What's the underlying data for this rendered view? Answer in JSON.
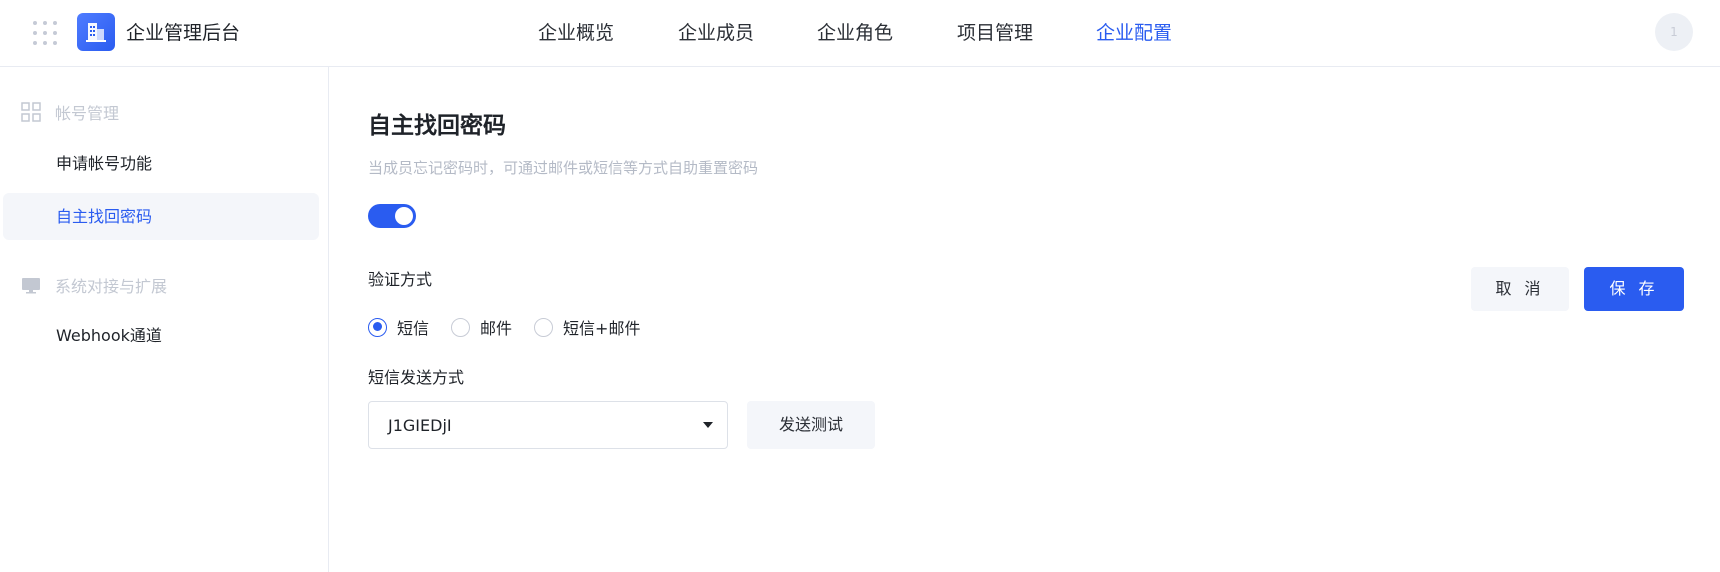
{
  "header": {
    "app_title": "企业管理后台",
    "nav": [
      {
        "label": "企业概览",
        "active": false
      },
      {
        "label": "企业成员",
        "active": false
      },
      {
        "label": "企业角色",
        "active": false
      },
      {
        "label": "项目管理",
        "active": false
      },
      {
        "label": "企业配置",
        "active": true
      }
    ],
    "avatar_text": "1"
  },
  "sidebar": {
    "groups": [
      {
        "label": "帐号管理",
        "icon": "grid-icon",
        "items": [
          {
            "label": "申请帐号功能",
            "active": false
          },
          {
            "label": "自主找回密码",
            "active": true
          }
        ]
      },
      {
        "label": "系统对接与扩展",
        "icon": "monitor-icon",
        "items": [
          {
            "label": "Webhook通道",
            "active": false
          }
        ]
      }
    ]
  },
  "main": {
    "title": "自主找回密码",
    "description": "当成员忘记密码时，可通过邮件或短信等方式自助重置密码",
    "enabled": true,
    "verify_label": "验证方式",
    "verify_options": [
      {
        "label": "短信",
        "checked": true
      },
      {
        "label": "邮件",
        "checked": false
      },
      {
        "label": "短信+邮件",
        "checked": false
      }
    ],
    "sms_label": "短信发送方式",
    "sms_select_value": "J1GIEDjI",
    "send_test_label": "发送测试",
    "cancel_label": "取 消",
    "save_label": "保 存"
  },
  "colors": {
    "accent": "#2a5cf0",
    "muted_text": "#b4bac6",
    "soft_bg": "#f4f6fa"
  }
}
